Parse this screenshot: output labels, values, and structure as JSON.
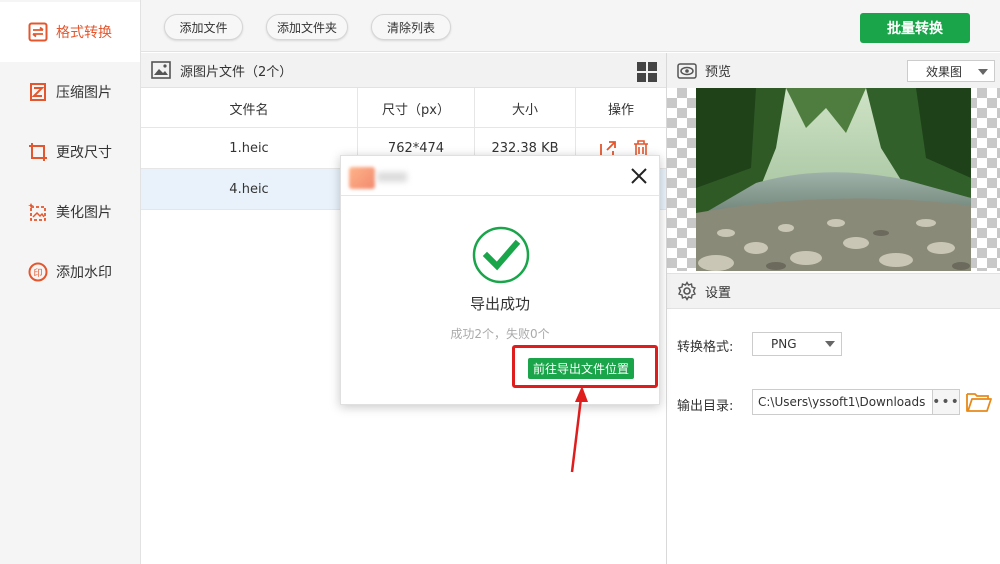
{
  "sidebar": {
    "items": [
      {
        "label": "格式转换",
        "icon": "convert-icon",
        "active": true
      },
      {
        "label": "压缩图片",
        "icon": "compress-icon",
        "active": false
      },
      {
        "label": "更改尺寸",
        "icon": "resize-icon",
        "active": false
      },
      {
        "label": "美化图片",
        "icon": "beautify-icon",
        "active": false
      },
      {
        "label": "添加水印",
        "icon": "watermark-icon",
        "active": false
      }
    ]
  },
  "toolbar": {
    "add_file": "添加文件",
    "add_folder": "添加文件夹",
    "clear_list": "清除列表",
    "batch_convert": "批量转换"
  },
  "file_panel": {
    "title": "源图片文件（2个）",
    "columns": [
      "文件名",
      "尺寸（px）",
      "大小",
      "操作"
    ],
    "rows": [
      {
        "name": "1.heic",
        "size_px": "762*474",
        "filesize": "232.38 KB"
      },
      {
        "name": "4.heic",
        "size_px": "",
        "filesize": ""
      }
    ]
  },
  "preview": {
    "title": "预览",
    "mode": "效果图"
  },
  "settings": {
    "title": "设置",
    "format_label": "转换格式:",
    "format_value": "PNG",
    "output_label": "输出目录:",
    "output_path": "C:\\Users\\yssoft1\\Downloads",
    "browse_dots": "•••"
  },
  "dialog": {
    "message": "导出成功",
    "summary": "成功2个，失败0个",
    "goto_button": "前往导出文件位置"
  },
  "colors": {
    "accent": "#e4572e",
    "green": "#1aa54a",
    "annotation_red": "#e01d1d"
  }
}
